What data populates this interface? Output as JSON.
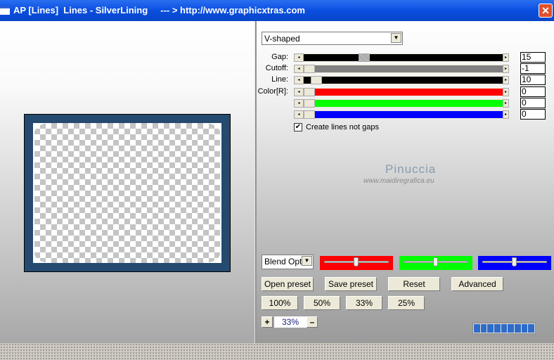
{
  "window": {
    "title": "AP [Lines]  Lines - SilverLining     --- > http://www.graphicxtras.com",
    "close": "✕"
  },
  "controls": {
    "mode_select": "V-shaped",
    "sliders": [
      {
        "label": "Gap:",
        "value": "15",
        "color": "#000000",
        "position": 0.3
      },
      {
        "label": "Cutoff:",
        "value": "-1",
        "color": "#808080",
        "position": 0.0
      },
      {
        "label": "Line:",
        "value": "10",
        "color": "#000000",
        "position": 0.04
      },
      {
        "label": "Color[R]:",
        "value": "0",
        "color": "#ff0000",
        "position": 0.0
      },
      {
        "label": "",
        "value": "0",
        "color": "#00ff00",
        "position": 0.0
      },
      {
        "label": "",
        "value": "0",
        "color": "#0000ff",
        "position": 0.0
      }
    ],
    "checkbox": {
      "label": "Create lines not gaps",
      "checked": true
    }
  },
  "watermark": {
    "name": "Pinuccia",
    "url": "www.maidiregrafica.eu"
  },
  "blend": {
    "select": "Blend Optio",
    "sliders": [
      {
        "color": "#ff0000",
        "position": 0.5
      },
      {
        "color": "#00ff00",
        "position": 0.5
      },
      {
        "color": "#0000ff",
        "position": 0.5
      }
    ]
  },
  "buttons": {
    "open_preset": "Open preset",
    "save_preset": "Save preset",
    "reset": "Reset",
    "advanced": "Advanced",
    "z100": "100%",
    "z50": "50%",
    "z33": "33%",
    "z25": "25%"
  },
  "zoom": {
    "plus": "+",
    "value": "33%",
    "minus": "–"
  },
  "progress": {
    "segments": 9
  }
}
